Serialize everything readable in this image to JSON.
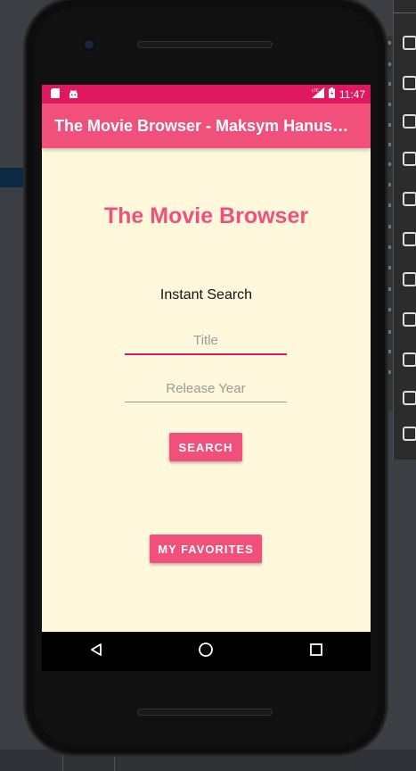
{
  "status_bar": {
    "time": "11:47",
    "left_icons": [
      "sd-card-icon",
      "android-icon"
    ],
    "right_icons": [
      "lte-signal-icon",
      "battery-icon"
    ]
  },
  "app_bar": {
    "title": "The Movie Browser - Maksym Hanush…"
  },
  "main": {
    "heading": "The Movie Browser",
    "subtitle": "Instant Search",
    "title_input": {
      "placeholder": "Title",
      "value": ""
    },
    "year_input": {
      "placeholder": "Release Year",
      "value": ""
    },
    "search_button": "SEARCH",
    "favorites_button": "MY FAVORITES"
  },
  "nav_bar": {
    "buttons": [
      "back-icon",
      "home-icon",
      "recents-icon"
    ]
  },
  "colors": {
    "status_bar": "#e0185f",
    "app_bar": "#f0507a",
    "accent": "#f0507a",
    "screen_background": "#fff8dc"
  }
}
